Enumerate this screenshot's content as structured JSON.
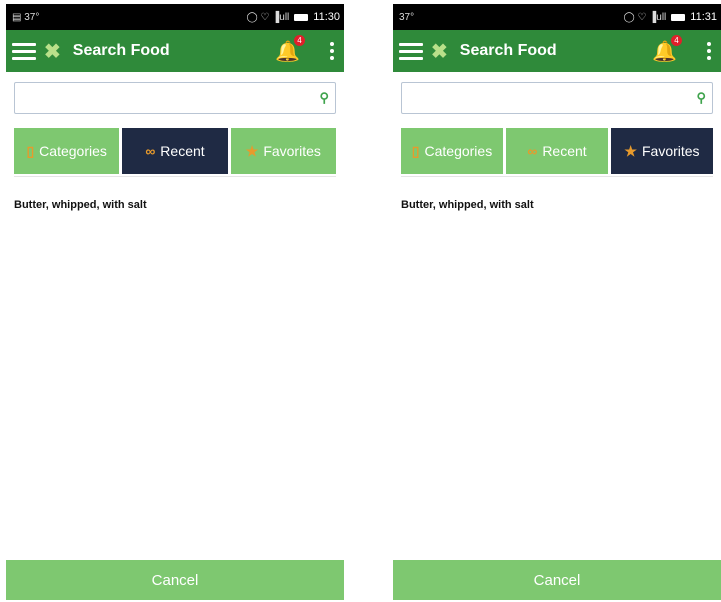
{
  "screens": [
    {
      "status": {
        "left_icons": "▤ 37°",
        "right_icons": "◯ ♡ ▐ull",
        "time": "11:30"
      },
      "appbar": {
        "title": "Search Food",
        "badge": "4"
      },
      "search": {
        "placeholder": ""
      },
      "tabs": [
        {
          "label": "Categories",
          "icon": "▯"
        },
        {
          "label": "Recent",
          "icon": "∞"
        },
        {
          "label": "Favorites",
          "icon": "★"
        }
      ],
      "active_tab": "Recent",
      "items": [
        "Butter, whipped, with salt"
      ],
      "cancel_label": "Cancel"
    },
    {
      "status": {
        "left_icons": "37°",
        "right_icons": "◯ ♡ ▐ull",
        "time": "11:31"
      },
      "appbar": {
        "title": "Search Food",
        "badge": "4"
      },
      "search": {
        "placeholder": ""
      },
      "tabs": [
        {
          "label": "Categories",
          "icon": "▯"
        },
        {
          "label": "Recent",
          "icon": "∞"
        },
        {
          "label": "Favorites",
          "icon": "★"
        }
      ],
      "active_tab": "Favorites",
      "items": [
        "Butter, whipped, with salt"
      ],
      "cancel_label": "Cancel"
    }
  ],
  "colors": {
    "appbar": "#2f8a3a",
    "tab": "#7ec870",
    "tab_active": "#1f2a44",
    "tab_icon": "#e79a2c",
    "badge": "#e0202a"
  }
}
